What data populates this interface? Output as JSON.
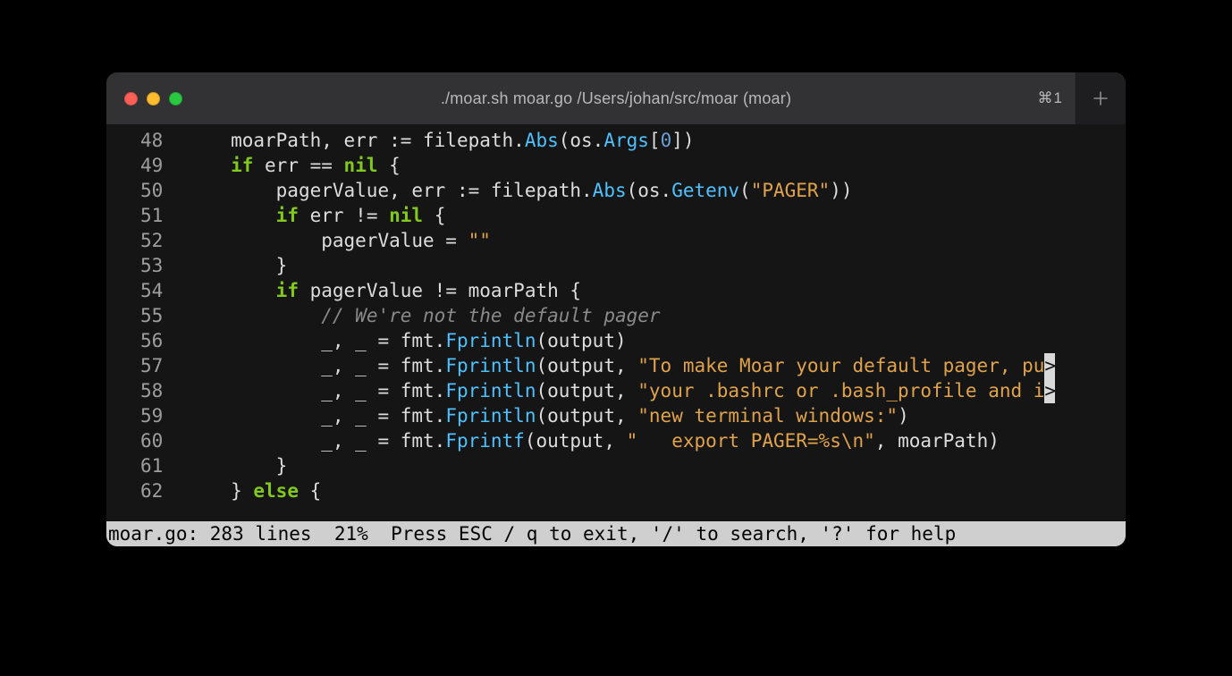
{
  "titlebar": {
    "title": "./moar.sh moar.go /Users/johan/src/moar (moar)",
    "shortcut": "⌘1",
    "traffic": {
      "close": "close-window",
      "minimize": "minimize-window",
      "fullscreen": "fullscreen-window"
    },
    "new_tab_icon": "plus-icon"
  },
  "wrap_glyph": ">",
  "code": {
    "lines": [
      {
        "num": "48",
        "prefix": "    moarPath, err := filepath.",
        "fn1": "Abs",
        "mid1": "(os.",
        "fn2": "Args",
        "mid2": "[",
        "num_lit": "0",
        "suffix": "])"
      },
      {
        "num": "49",
        "prefix": "    ",
        "kw1": "if",
        "mid1": " err == ",
        "kw2": "nil",
        "suffix": " {"
      },
      {
        "num": "50",
        "prefix": "        pagerValue, err := filepath.",
        "fn1": "Abs",
        "mid1": "(os.",
        "fn2": "Getenv",
        "mid2": "(",
        "str": "\"PAGER\"",
        "suffix": "))"
      },
      {
        "num": "51",
        "prefix": "        ",
        "kw1": "if",
        "mid1": " err != ",
        "kw2": "nil",
        "suffix": " {"
      },
      {
        "num": "52",
        "prefix": "            pagerValue = ",
        "str": "\"\""
      },
      {
        "num": "53",
        "prefix": "        }"
      },
      {
        "num": "54",
        "prefix": "        ",
        "kw1": "if",
        "suffix": " pagerValue != moarPath {"
      },
      {
        "num": "55",
        "prefix": "            ",
        "comment": "// We're not the default pager"
      },
      {
        "num": "56",
        "prefix": "            _, _ = fmt.",
        "fn1": "Fprintln",
        "suffix": "(output)"
      },
      {
        "num": "57",
        "prefix": "            _, _ = fmt.",
        "fn1": "Fprintln",
        "mid1": "(output, ",
        "str": "\"To make Moar your default pager, pu",
        "wrap": true
      },
      {
        "num": "58",
        "prefix": "            _, _ = fmt.",
        "fn1": "Fprintln",
        "mid1": "(output, ",
        "str": "\"your .bashrc or .bash_profile and i",
        "wrap": true
      },
      {
        "num": "59",
        "prefix": "            _, _ = fmt.",
        "fn1": "Fprintln",
        "mid1": "(output, ",
        "str": "\"new terminal windows:\"",
        "suffix": ")"
      },
      {
        "num": "60",
        "prefix": "            _, _ = fmt.",
        "fn1": "Fprintf",
        "mid1": "(output, ",
        "str": "\"   export PAGER=%s\\n\"",
        "suffix": ", moarPath)"
      },
      {
        "num": "61",
        "prefix": "        }"
      },
      {
        "num": "62",
        "prefix": "    } ",
        "kw1": "else",
        "suffix": " {"
      }
    ]
  },
  "statusbar": {
    "text": "moar.go: 283 lines  21%  Press ESC / q to exit, '/' to search, '?' for help"
  }
}
